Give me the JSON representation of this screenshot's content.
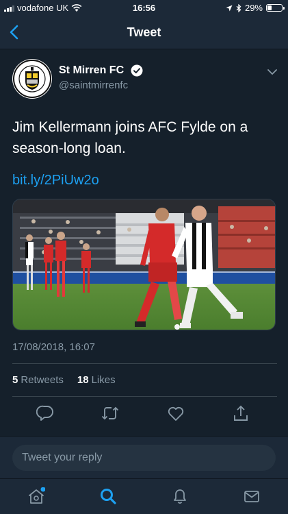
{
  "status_bar": {
    "carrier": "vodafone UK",
    "time": "16:56",
    "battery": "29%",
    "battery_level": 0.29
  },
  "nav": {
    "title": "Tweet"
  },
  "tweet": {
    "author_name": "St Mirren FC",
    "author_handle": "@saintmirrenfc",
    "text": "Jim Kellermann joins AFC Fylde on a season-long loan.",
    "link": "bit.ly/2PiUw2o",
    "timestamp": "17/08/2018, 16:07",
    "retweets_count": "5",
    "retweets_label": "Retweets",
    "likes_count": "18",
    "likes_label": "Likes"
  },
  "reply": {
    "placeholder": "Tweet your reply"
  },
  "colors": {
    "background": "#15202b",
    "bar": "#1c2938",
    "accent": "#1da1f2",
    "secondary_text": "#8899a6"
  },
  "icons": {
    "actions": [
      "reply-icon",
      "retweet-icon",
      "like-icon",
      "share-icon"
    ],
    "tabs": [
      "home-icon",
      "search-icon",
      "notifications-icon",
      "messages-icon"
    ]
  }
}
